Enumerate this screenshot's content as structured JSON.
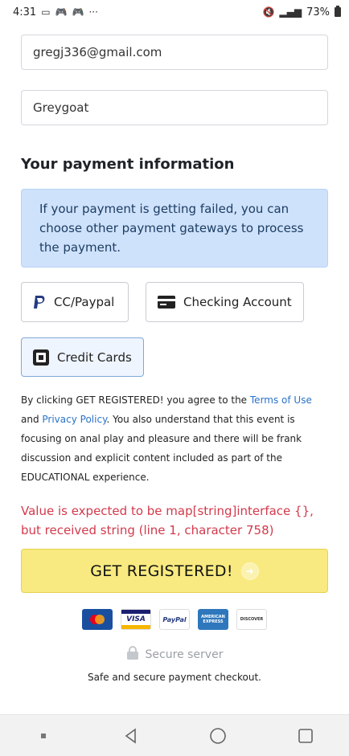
{
  "status_bar": {
    "time": "4:31",
    "battery": "73%"
  },
  "form": {
    "email_value": "gregj336@gmail.com",
    "name_value": "Greygoat"
  },
  "payment": {
    "title": "Your payment information",
    "notice": "If your payment is getting failed, you can choose other payment gateways to process the payment.",
    "options": [
      {
        "label": "CC/Paypal",
        "icon": "paypal-icon"
      },
      {
        "label": "Checking Account",
        "icon": "bank-card-icon"
      },
      {
        "label": "Credit Cards",
        "icon": "square-icon",
        "selected": true
      }
    ]
  },
  "terms": {
    "part1": "By clicking GET REGISTERED! you agree to the ",
    "terms_link": "Terms of Use",
    "part2": " and ",
    "privacy_link": "Privacy Policy",
    "part3": ". You also understand that this event is focusing on anal play and pleasure and there will be frank discussion and explicit content included as part of the EDUCATIONAL experience."
  },
  "error": "Value is expected to be map[string]interface {}, but received string (line 1, character 758)",
  "register_button": "GET REGISTERED!",
  "card_logos": [
    "mastercard",
    "VISA",
    "PayPal",
    "AMERICAN EXPRESS",
    "DISCOVER"
  ],
  "secure": {
    "label": "Secure server",
    "subtitle": "Safe and secure payment checkout."
  },
  "colors": {
    "accent_yellow": "#f8ea80",
    "info_blue": "#cfe2fb",
    "error_red": "#d23a4c",
    "link_blue": "#2a73c8"
  }
}
